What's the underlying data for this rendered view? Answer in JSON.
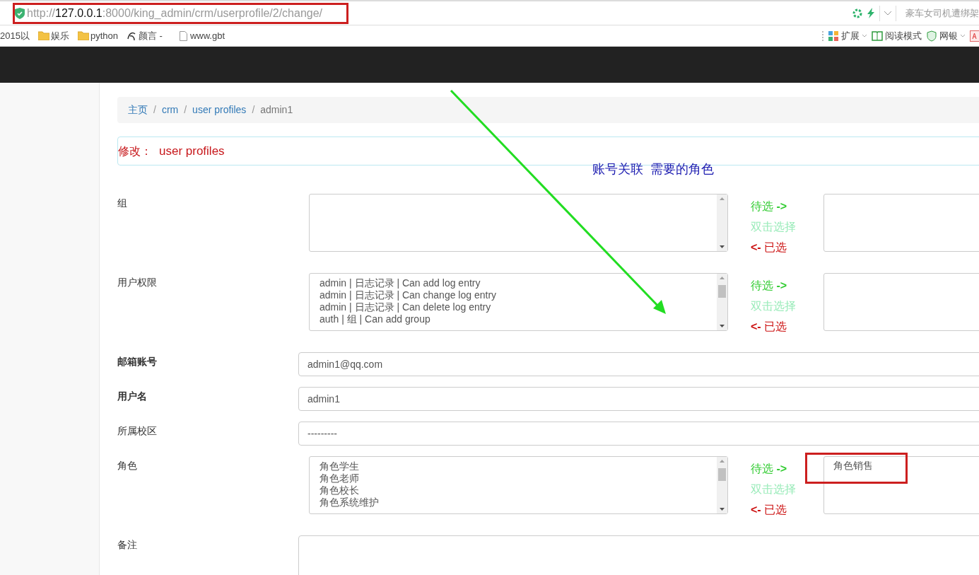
{
  "browser": {
    "url": {
      "scheme": "http://",
      "host": "127.0.0.1",
      "rest": ":8000/king_admin/crm/userprofile/2/change/",
      "highlighted": true
    },
    "news": "豪车女司机遭绑架",
    "bookmarks": [
      {
        "kind": "text",
        "label": "2015以"
      },
      {
        "kind": "folder",
        "label": "娱乐"
      },
      {
        "kind": "folder",
        "label": "python"
      },
      {
        "kind": "site",
        "label": "颜言 -"
      },
      {
        "kind": "page",
        "label": "www.gbt"
      }
    ],
    "tools": [
      {
        "kind": "apps",
        "label": "扩展",
        "menu": true
      },
      {
        "kind": "book",
        "label": "阅读模式"
      },
      {
        "kind": "bank",
        "label": "网银",
        "menu": true
      },
      {
        "kind": "translate"
      }
    ]
  },
  "breadcrumb": [
    {
      "label": "主页",
      "kind": "link"
    },
    {
      "sep": "/",
      "label": "crm",
      "kind": "link"
    },
    {
      "sep": "/",
      "label": "user profiles",
      "kind": "link"
    },
    {
      "sep": "/",
      "label": "admin1",
      "kind": "current"
    }
  ],
  "panel_title": {
    "prefix": "修改：",
    "model": "user profiles"
  },
  "annotation": "账号关联  需要的角色",
  "fields": [
    {
      "kind": "dual_list",
      "label": "组",
      "bold": false,
      "hints": [
        "待选 **->**",
        "双击选择",
        "**<-** 已选"
      ]
    },
    {
      "kind": "dual_list",
      "label": "用户权限",
      "bold": false,
      "options": [
        "admin | 日志记录 | Can add log entry",
        "admin | 日志记录 | Can change log entry",
        "admin | 日志记录 | Can delete log entry",
        "auth | 组 | Can add group"
      ],
      "hints": [
        "待选 **->**",
        "双击选择",
        "**<-** 已选"
      ]
    },
    {
      "kind": "text",
      "label": "邮箱账号",
      "bold": true,
      "value": "admin1@qq.com"
    },
    {
      "kind": "text",
      "label": "用户名",
      "bold": true,
      "value": "admin1"
    },
    {
      "kind": "select",
      "label": "所属校区",
      "bold": false,
      "value": "---------"
    },
    {
      "kind": "dual_list",
      "label": "角色",
      "bold": false,
      "options": [
        "角色学生",
        "角色老师",
        "角色校长",
        "角色系统维护"
      ],
      "hints": [
        "待选 **->**",
        "双击选择",
        "**<-** 已选"
      ],
      "chosen": [
        {
          "label": "角色销售",
          "highlighted": true
        }
      ]
    },
    {
      "kind": "textarea",
      "label": "备注",
      "bold": false
    }
  ]
}
